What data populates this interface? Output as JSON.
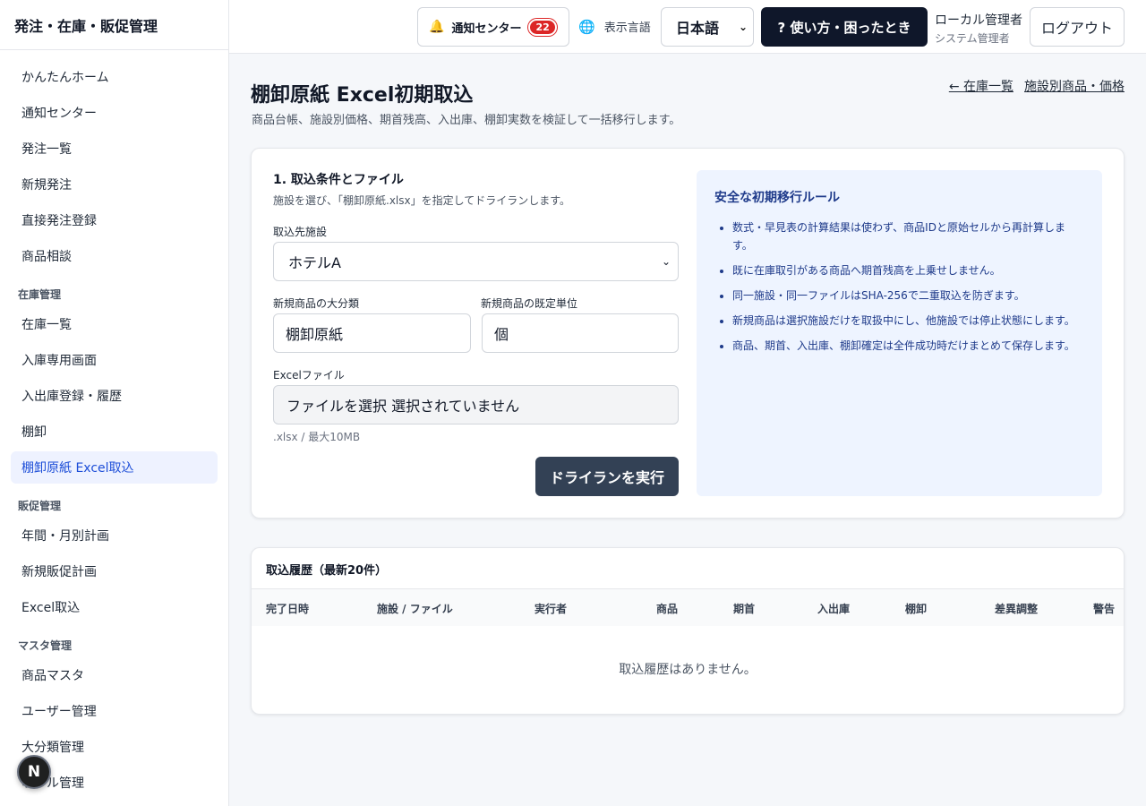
{
  "app": {
    "title": "発注・在庫・販促管理"
  },
  "sidebar": {
    "items_top": [
      "かんたんホーム",
      "通知センター",
      "発注一覧",
      "新規発注",
      "直接発注登録",
      "商品相談"
    ],
    "group_inventory": "在庫管理",
    "items_inventory": [
      "在庫一覧",
      "入庫専用画面",
      "入出庫登録・履歴",
      "棚卸",
      "棚卸原紙 Excel取込"
    ],
    "group_promo": "販促管理",
    "items_promo": [
      "年間・月別計画",
      "新規販促計画",
      "Excel取込"
    ],
    "group_master": "マスタ管理",
    "items_master": [
      "商品マスタ",
      "ユーザー管理",
      "大分類管理",
      "ホテル管理"
    ],
    "next_badge": "N"
  },
  "header": {
    "notification_label": "通知センター",
    "notification_count": "22",
    "language_label": "表示言語",
    "language_value": "日本語",
    "help_label": "? 使い方・困ったとき",
    "user_name": "ローカル管理者",
    "user_role": "システム管理者",
    "logout_label": "ログアウト"
  },
  "page": {
    "title": "棚卸原紙 Excel初期取込",
    "subtitle": "商品台帳、施設別価格、期首残高、入出庫、棚卸実数を検証して一括移行します。",
    "link_back": "← 在庫一覧",
    "link_prices": "施設別商品・価格"
  },
  "form": {
    "section_title": "1. 取込条件とファイル",
    "section_sub": "施設を選び、「棚卸原紙.xlsx」を指定してドライランします。",
    "facility_label": "取込先施設",
    "facility_value": "ホテルA",
    "category_label": "新規商品の大分類",
    "category_value": "棚卸原紙",
    "unit_label": "新規商品の既定単位",
    "unit_value": "個",
    "file_label": "Excelファイル",
    "file_value": "ファイルを選択 選択されていません",
    "file_hint": ".xlsx / 最大10MB",
    "run_label": "ドライランを実行"
  },
  "rules": {
    "title": "安全な初期移行ルール",
    "items": [
      "数式・早見表の計算結果は使わず、商品IDと原始セルから再計算します。",
      "既に在庫取引がある商品へ期首残高を上乗せしません。",
      "同一施設・同一ファイルはSHA-256で二重取込を防ぎます。",
      "新規商品は選択施設だけを取扱中にし、他施設では停止状態にします。",
      "商品、期首、入出庫、棚卸確定は全件成功時だけまとめて保存します。"
    ]
  },
  "history": {
    "title": "取込履歴（最新20件）",
    "columns": [
      "完了日時",
      "施設 / ファイル",
      "実行者",
      "商品",
      "期首",
      "入出庫",
      "棚卸",
      "差異調整",
      "警告"
    ],
    "empty": "取込履歴はありません。"
  },
  "icons": {
    "bell": "bell-icon",
    "globe": "globe-icon",
    "chevron": "chevron-down-icon"
  },
  "colors": {
    "primary_dark": "#0f172a",
    "accent_blue": "#1d4ed8",
    "badge_red": "#dc2626",
    "run_button": "#334155"
  }
}
